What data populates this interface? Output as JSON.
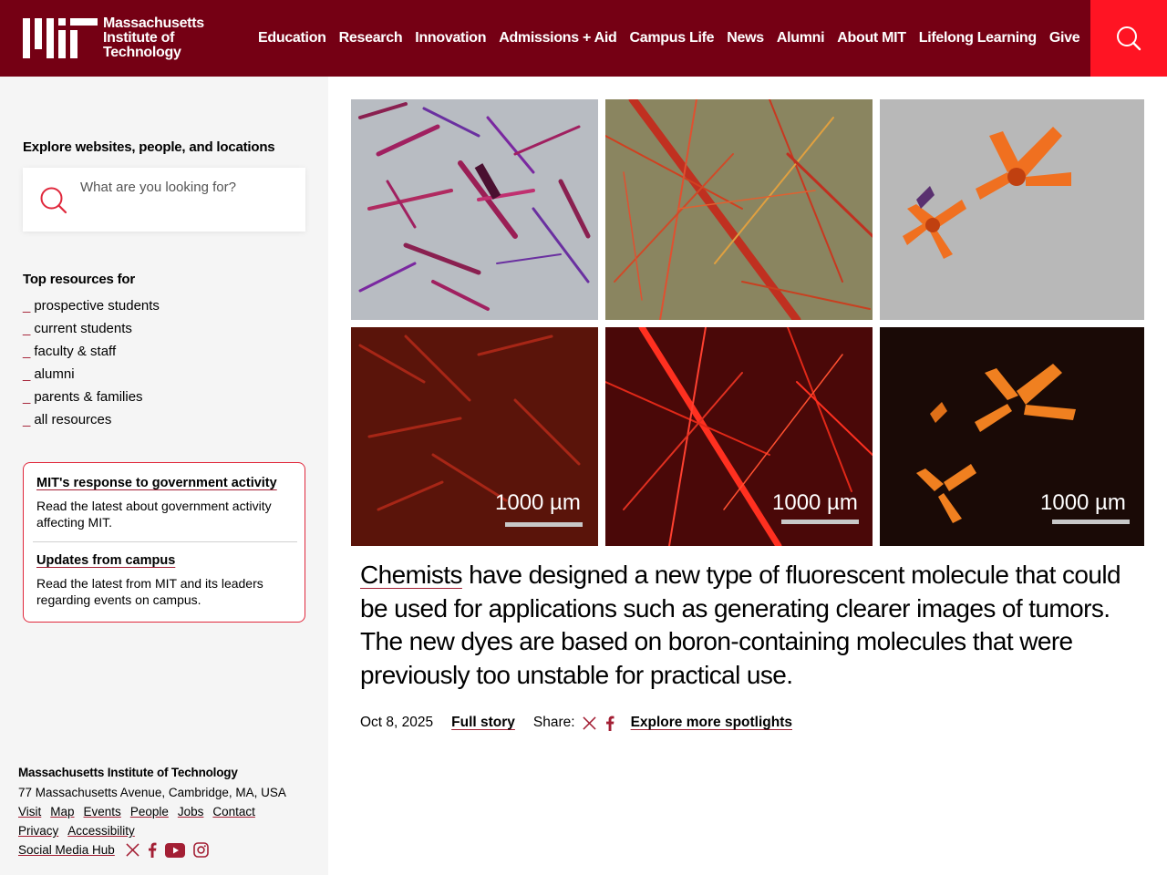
{
  "header": {
    "logo_text": "Massachusetts\nInstitute of\nTechnology",
    "nav": [
      "Education",
      "Research",
      "Innovation",
      "Admissions + Aid",
      "Campus Life",
      "News",
      "Alumni",
      "About MIT",
      "Lifelong Learning",
      "Give"
    ],
    "brand_color": "#750014",
    "search_color": "#ff1423"
  },
  "sidebar": {
    "explore_title": "Explore websites, people, and locations",
    "search_placeholder": "What are you looking for?",
    "top_resources_title": "Top resources for",
    "resources": [
      "prospective students",
      "current students",
      "faculty & staff",
      "alumni",
      "parents & families",
      "all resources"
    ],
    "notices": [
      {
        "title": "MIT's response to government activity",
        "text": "Read the latest about government activity affecting MIT."
      },
      {
        "title": "Updates from campus",
        "text": "Read the latest from MIT and its leaders regarding events on campus."
      }
    ]
  },
  "footer": {
    "name": "Massachusetts Institute of Technology",
    "address": "77 Massachusetts Avenue, Cambridge, MA, USA",
    "links_row1": [
      "Visit",
      "Map",
      "Events",
      "People",
      "Jobs",
      "Contact"
    ],
    "links_row2": [
      "Privacy",
      "Accessibility"
    ],
    "social_hub": "Social Media Hub",
    "social_icons": [
      "x-icon",
      "facebook-icon",
      "youtube-icon",
      "instagram-icon"
    ]
  },
  "spotlight": {
    "scale_labels": [
      "1000 µm",
      "1000 µm",
      "1000 µm"
    ],
    "lead_word": "Chemists",
    "text": " have designed a new type of fluorescent molecule that could be used for applications such as generating clearer images of tumors. The new dyes are based on boron-containing molecules that were previously too unstable for practical use.",
    "date": "Oct 8, 2025",
    "full_story": "Full story",
    "share_label": "Share:",
    "share_icons": [
      "x-icon",
      "facebook-icon"
    ],
    "explore_more": "Explore more spotlights"
  }
}
